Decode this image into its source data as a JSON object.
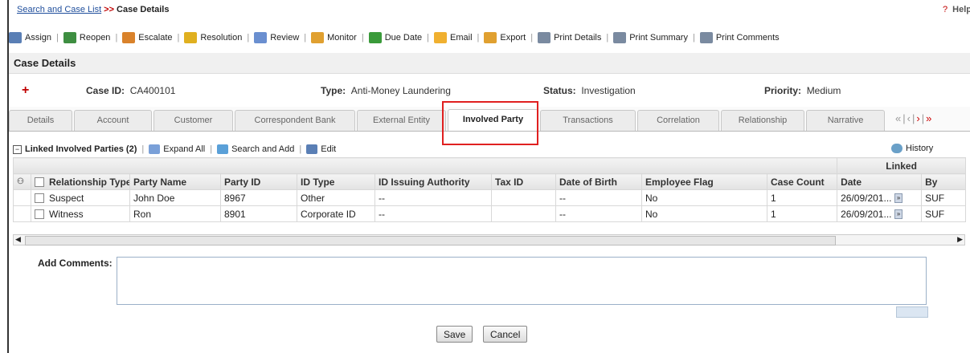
{
  "breadcrumb": {
    "link": "Search and Case List",
    "separator": ">>",
    "current": "Case Details"
  },
  "help": {
    "icon": "?",
    "label": "Help"
  },
  "toolbar": [
    {
      "label": "Assign",
      "icon": "assign-icon",
      "color": "#5a7fb5"
    },
    {
      "label": "Reopen",
      "icon": "reopen-icon",
      "color": "#3e8e41"
    },
    {
      "label": "Escalate",
      "icon": "escalate-icon",
      "color": "#d9822b"
    },
    {
      "label": "Resolution",
      "icon": "resolution-icon",
      "color": "#e0b020"
    },
    {
      "label": "Review",
      "icon": "review-icon",
      "color": "#6a8fd0"
    },
    {
      "label": "Monitor",
      "icon": "monitor-icon",
      "color": "#e0a030"
    },
    {
      "label": "Due Date",
      "icon": "due-date-icon",
      "color": "#3a9a3a"
    },
    {
      "label": "Email",
      "icon": "email-icon",
      "color": "#f0b030"
    },
    {
      "label": "Export",
      "icon": "export-icon",
      "color": "#e0a030"
    },
    {
      "label": "Print Details",
      "icon": "printer-icon",
      "color": "#7a8aa0"
    },
    {
      "label": "Print Summary",
      "icon": "printer-icon",
      "color": "#7a8aa0"
    },
    {
      "label": "Print Comments",
      "icon": "printer-icon",
      "color": "#7a8aa0"
    }
  ],
  "section_title": "Case Details",
  "case": {
    "add_icon": "+",
    "id_label": "Case ID:",
    "id_value": "CA400101",
    "type_label": "Type:",
    "type_value": "Anti-Money Laundering",
    "status_label": "Status:",
    "status_value": "Investigation",
    "priority_label": "Priority:",
    "priority_value": "Medium"
  },
  "tabs": [
    "Details",
    "Account",
    "Customer",
    "Correspondent Bank",
    "External Entity",
    "Involved Party",
    "Transactions",
    "Correlation",
    "Relationship",
    "Narrative"
  ],
  "active_tab": "Involved Party",
  "tab_nav": {
    "first": "«",
    "sep": "|",
    "prev": "‹",
    "next": "›",
    "last": "»"
  },
  "panel": {
    "title": "Linked Involved Parties (2)",
    "expand_all": "Expand All",
    "search_add": "Search and Add",
    "edit": "Edit",
    "history": "History"
  },
  "grid": {
    "group_header": "Linked",
    "columns": [
      "Relationship Type",
      "Party Name",
      "Party ID",
      "ID Type",
      "ID Issuing Authority",
      "Tax ID",
      "Date of Birth",
      "Employee Flag",
      "Case Count",
      "Date",
      "By"
    ],
    "rows": [
      [
        "Suspect",
        "John Doe",
        "8967",
        "Other",
        "--",
        "",
        "--",
        "No",
        "1",
        "26/09/201...",
        "SUF"
      ],
      [
        "Witness",
        "Ron",
        "8901",
        "Corporate ID",
        "--",
        "",
        "--",
        "No",
        "1",
        "26/09/201...",
        "SUF"
      ]
    ]
  },
  "comments": {
    "label": "Add Comments:",
    "value": ""
  },
  "buttons": {
    "save": "Save",
    "cancel": "Cancel"
  }
}
